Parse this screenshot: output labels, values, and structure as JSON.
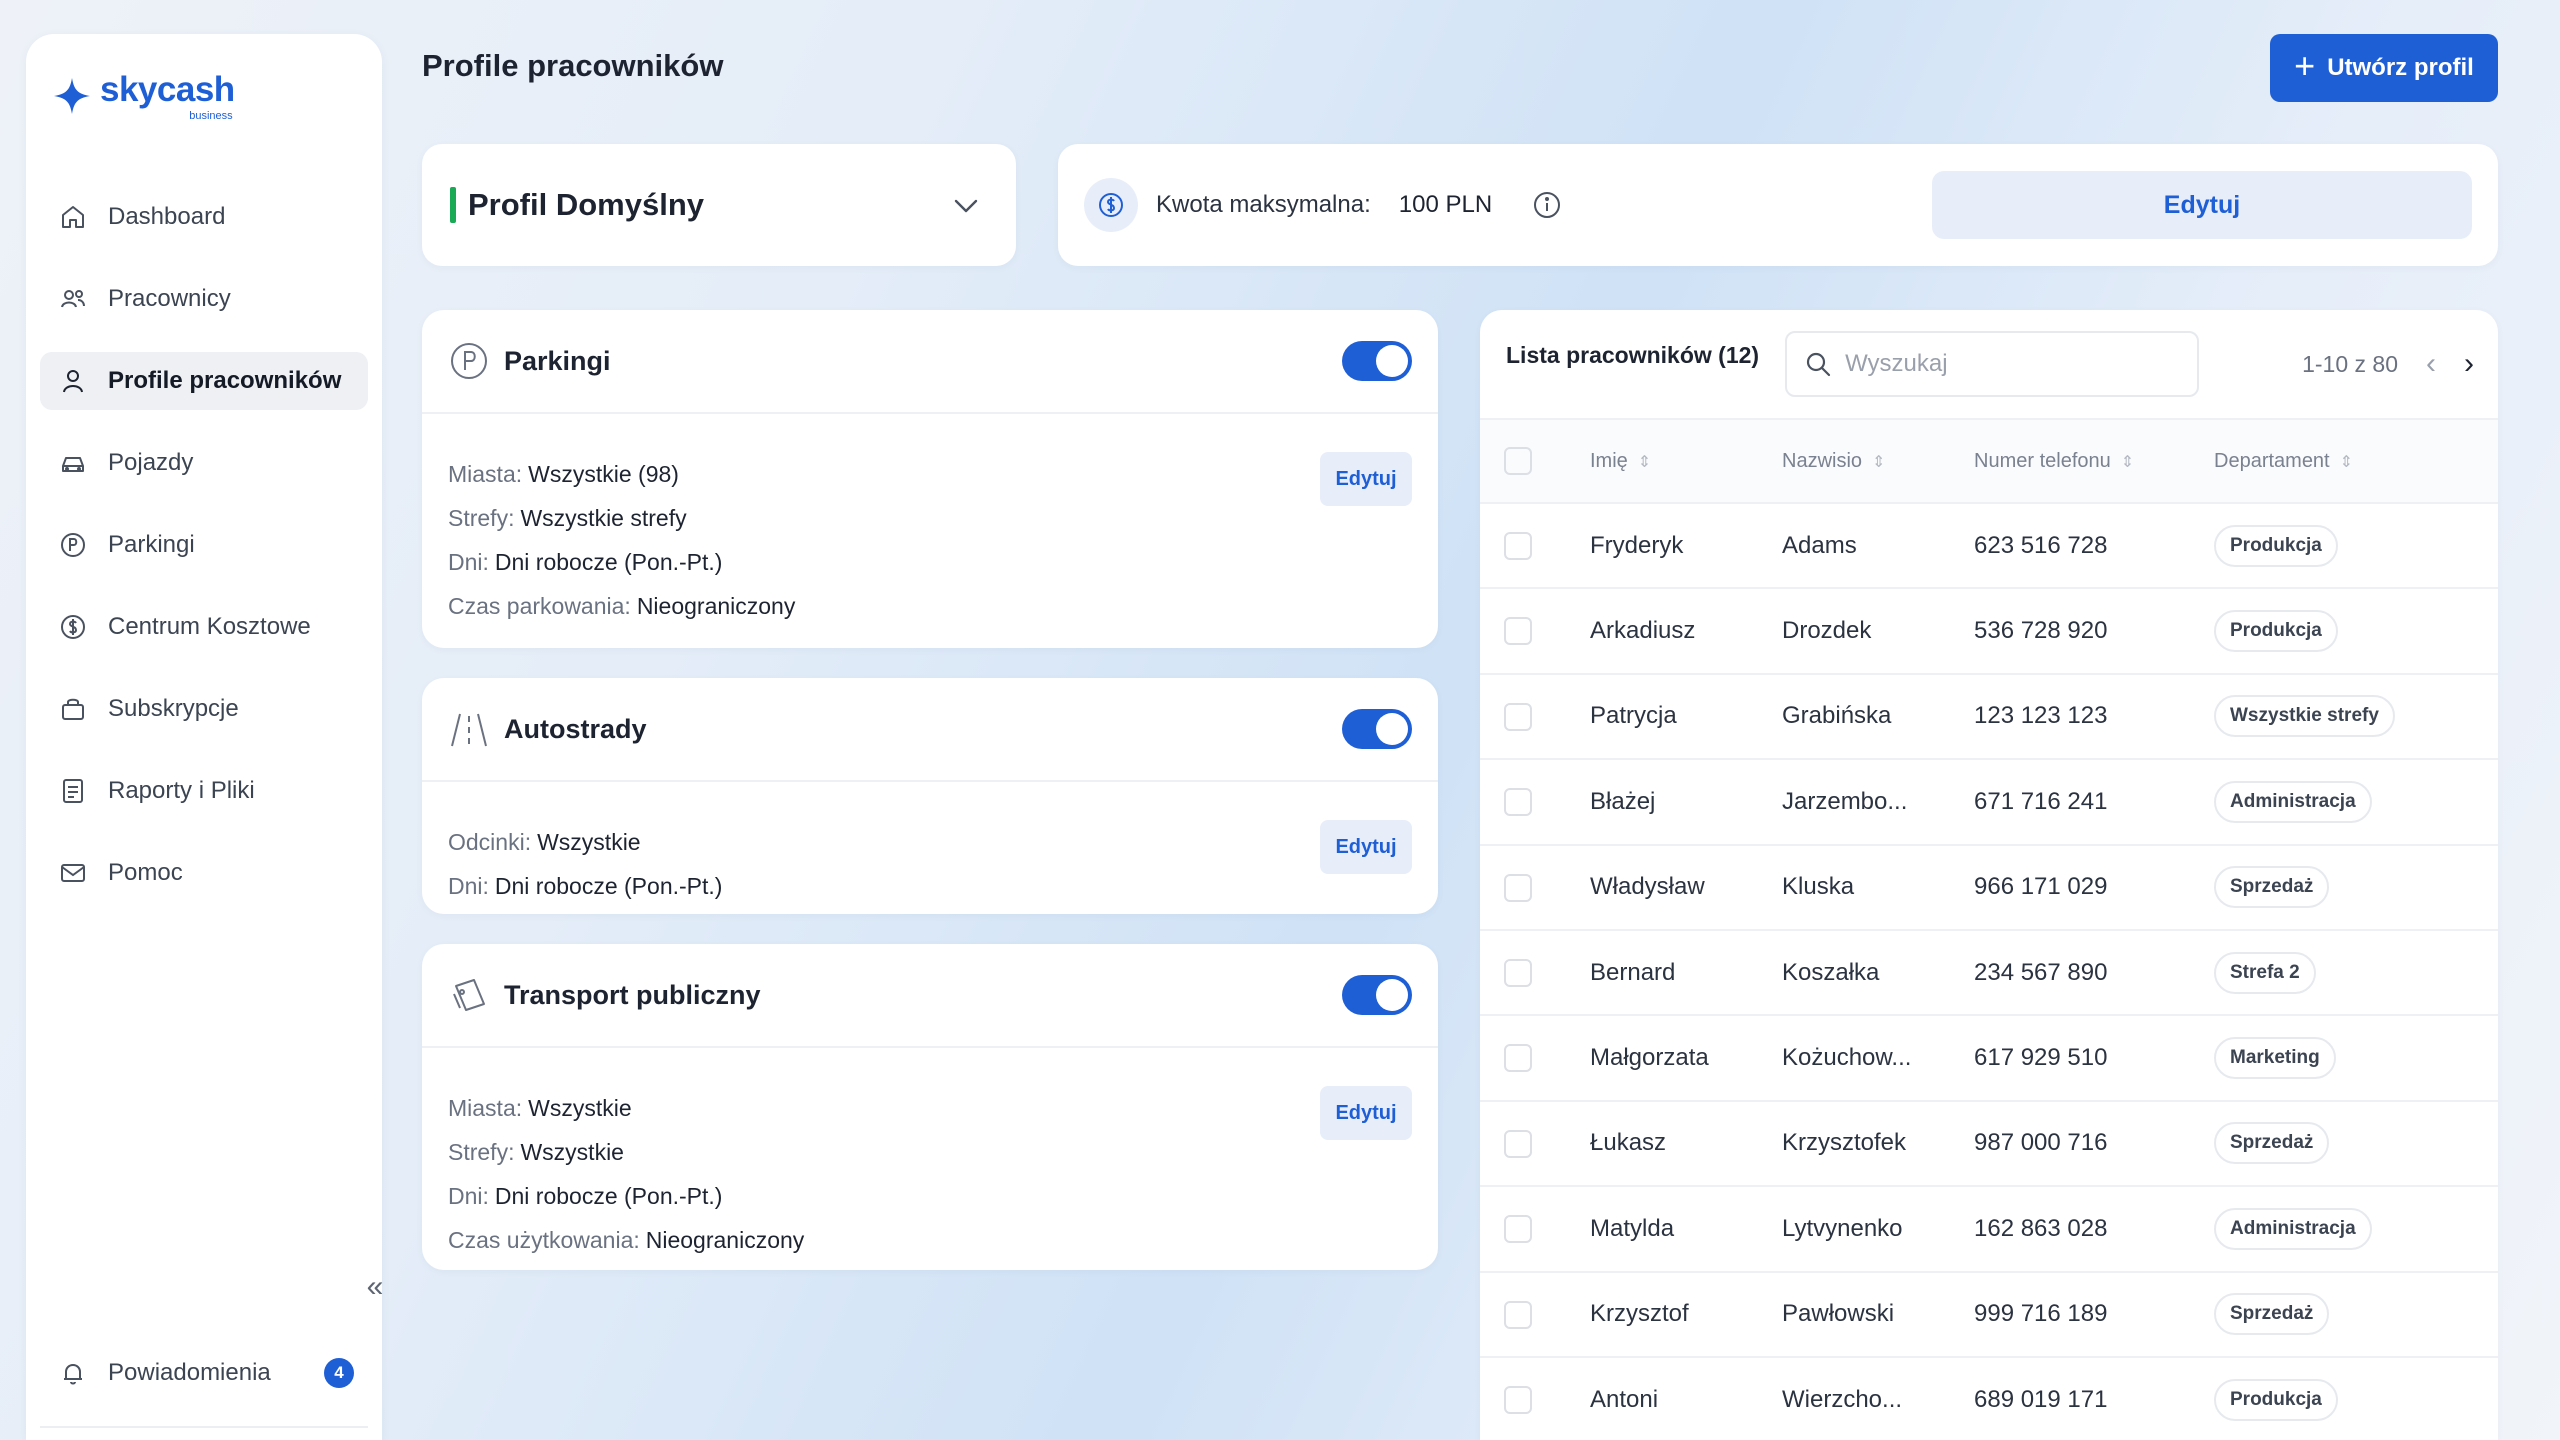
{
  "brand": {
    "name": "skycash",
    "sub": "business",
    "color": "#1f5fd6"
  },
  "sidebar": {
    "items": [
      {
        "label": "Dashboard",
        "icon": "home-icon"
      },
      {
        "label": "Pracownicy",
        "icon": "users-icon"
      },
      {
        "label": "Profile pracowników",
        "icon": "user-icon",
        "active": true
      },
      {
        "label": "Pojazdy",
        "icon": "car-icon"
      },
      {
        "label": "Parkingi",
        "icon": "parking-icon"
      },
      {
        "label": "Centrum Kosztowe",
        "icon": "coin-icon"
      },
      {
        "label": "Subskrypcje",
        "icon": "bag-icon"
      },
      {
        "label": "Raporty i Pliki",
        "icon": "document-icon"
      },
      {
        "label": "Pomoc",
        "icon": "mail-icon"
      }
    ],
    "collapse_glyph": "«",
    "notifications": {
      "label": "Powiadomienia",
      "count": "4"
    }
  },
  "header": {
    "title": "Profile pracowników",
    "create_button": "Utwórz profil"
  },
  "profile": {
    "name": "Profil Domyślny",
    "status_color": "#1aaa55"
  },
  "max_amount": {
    "label": "Kwota maksymalna:",
    "value": "100 PLN",
    "edit_label": "Edytuj"
  },
  "cards": {
    "parking": {
      "title": "Parkingi",
      "enabled": true,
      "edit_label": "Edytuj",
      "rows": [
        {
          "label": "Miasta:",
          "value": "Wszystkie (98)"
        },
        {
          "label": "Strefy:",
          "value": "Wszystkie strefy"
        },
        {
          "label": "Dni:",
          "value": "Dni robocze (Pon.-Pt.)"
        },
        {
          "label": "Czas parkowania:",
          "value": "Nieograniczony"
        }
      ]
    },
    "highways": {
      "title": "Autostrady",
      "enabled": true,
      "edit_label": "Edytuj",
      "rows": [
        {
          "label": "Odcinki:",
          "value": "Wszystkie"
        },
        {
          "label": "Dni:",
          "value": "Dni robocze (Pon.-Pt.)"
        }
      ]
    },
    "transport": {
      "title": "Transport publiczny",
      "enabled": true,
      "edit_label": "Edytuj",
      "rows": [
        {
          "label": "Miasta:",
          "value": "Wszystkie"
        },
        {
          "label": "Strefy:",
          "value": "Wszystkie"
        },
        {
          "label": "Dni:",
          "value": "Dni robocze (Pon.-Pt.)"
        },
        {
          "label": "Czas użytkowania:",
          "value": "Nieograniczony"
        }
      ]
    }
  },
  "employees": {
    "title": "Lista pracowników (12)",
    "search_placeholder": "Wyszukaj",
    "pagination": "1-10 z 80",
    "columns": [
      "Imię",
      "Nazwisio",
      "Numer telefonu",
      "Departament"
    ],
    "rows": [
      [
        "Fryderyk",
        "Adams",
        "623 516 728",
        "Produkcja"
      ],
      [
        "Arkadiusz",
        "Drozdek",
        "536 728 920",
        "Produkcja"
      ],
      [
        "Patrycja",
        "Grabińska",
        "123 123 123",
        "Wszystkie strefy"
      ],
      [
        "Błażej",
        "Jarzembo...",
        "671 716 241",
        "Administracja"
      ],
      [
        "Władysław",
        "Kluska",
        "966 171 029",
        "Sprzedaż"
      ],
      [
        "Bernard",
        "Koszałka",
        "234 567 890",
        "Strefa 2"
      ],
      [
        "Małgorzata",
        "Kożuchow...",
        "617 929 510",
        "Marketing"
      ],
      [
        "Łukasz",
        "Krzysztofek",
        "987 000 716",
        "Sprzedaż"
      ],
      [
        "Matylda",
        "Lytvynenko",
        "162 863 028",
        "Administracja"
      ],
      [
        "Krzysztof",
        "Pawłowski",
        "999 716 189",
        "Sprzedaż"
      ],
      [
        "Antoni",
        "Wierzcho...",
        "689 019 171",
        "Produkcja"
      ]
    ]
  }
}
